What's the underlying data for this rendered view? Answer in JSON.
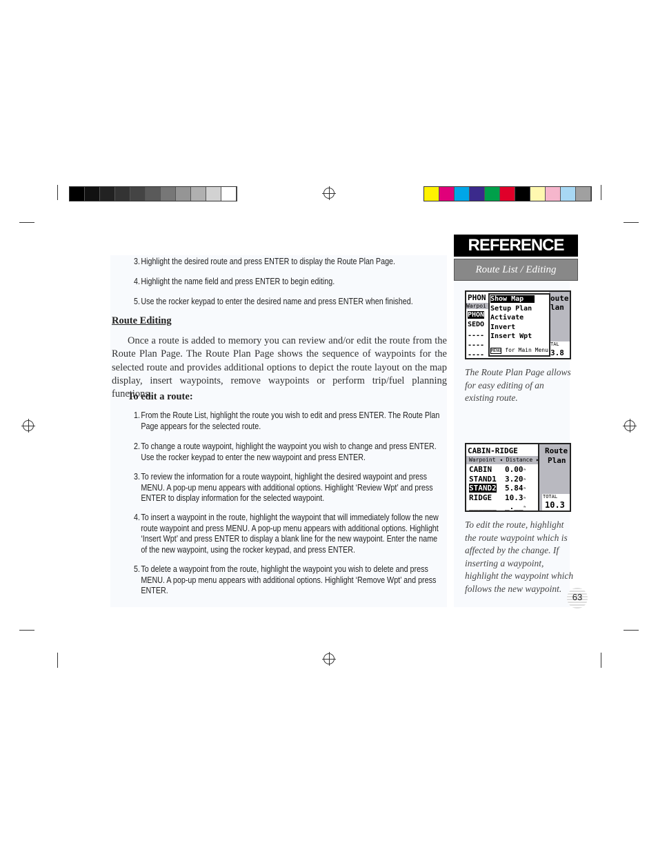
{
  "colorbars": {
    "grayscale": [
      "#000000",
      "#111111",
      "#222222",
      "#333333",
      "#444444",
      "#5a5a5a",
      "#777777",
      "#959595",
      "#b0b0b0",
      "#d2d2d2",
      "#ffffff"
    ],
    "process": [
      "#fff200",
      "#e0007a",
      "#00a6e8",
      "#3b2a8c",
      "#00a04a",
      "#e0002a",
      "#000000",
      "#fff8b0",
      "#f6b6cc",
      "#a8d8f4",
      "#a0a0a0"
    ]
  },
  "steps_top": [
    {
      "num": "3.",
      "text": "Highlight the desired route and press ENTER to display the Route Plan Page."
    },
    {
      "num": "4.",
      "text": "Highlight the name field and press ENTER to begin editing."
    },
    {
      "num": "5.",
      "text": "Use the rocker keypad to enter the desired name and press ENTER when finished."
    }
  ],
  "heading": "Route Editing",
  "paragraph": "Once a route is added to memory you can review and/or edit the route from the Route Plan Page. The Route Plan Page shows the sequence of waypoints for the selected route and provides additional options to depict the route layout on the map display, insert waypoints, remove waypoints or perform trip/fuel planning functions.",
  "subheading": "To edit a route:",
  "steps": [
    {
      "num": "1.",
      "text": "From the Route List, highlight the route you wish to edit and press ENTER. The Route Plan Page appears for the selected route."
    },
    {
      "num": "2.",
      "text": "To change a route waypoint, highlight the waypoint you wish to change and press ENTER. Use the rocker keypad to enter the new waypoint and press ENTER."
    },
    {
      "num": "3.",
      "text": "To review the information for a route waypoint, highlight the desired waypoint and press MENU. A pop-up menu appears with additional options. Highlight ‘Review Wpt’ and press ENTER to display information for the selected waypoint."
    },
    {
      "num": "4.",
      "text": "To insert a waypoint in the route, highlight the waypoint that will immediately follow the new route waypoint and press MENU. A pop-up menu appears with additional options. Highlight ‘Insert Wpt’ and press ENTER to display a blank line for the new waypoint. Enter the name of the new waypoint, using the rocker keypad, and press ENTER."
    },
    {
      "num": "5.",
      "text": "To delete a waypoint from the route, highlight the waypoint you wish to delete and press MENU. A pop-up menu appears with additional options. Highlight ‘Remove Wpt’ and press ENTER."
    }
  ],
  "sidebar": {
    "tab": "REFERENCE",
    "section": "Route List / Editing",
    "caption1": "The Route Plan Page allows for easy editing of an existing route.",
    "caption2": "To edit the route, highlight the route waypoint which is affected by the change. If inserting a waypoint, highlight the waypoint which follows the new waypoint."
  },
  "screen1": {
    "bg_title": "PHON",
    "bg_sub": "Warpoi",
    "bg_rows": [
      "PHON",
      "SEDO",
      "----",
      "----",
      "----"
    ],
    "right_title": "oute",
    "right_sub": "lan",
    "total_label": "TAL",
    "total": "3.8",
    "menu": [
      "Show Map",
      "Setup Plan",
      "Activate",
      "Invert",
      "Insert Wpt"
    ],
    "menu_key": "MENU",
    "menu_hint": "for Main Menu"
  },
  "screen2": {
    "title": "CABIN-RIDGE",
    "col1": "Warpoint",
    "col2": "◂ Distance ▸",
    "rows": [
      {
        "wpt": "CABIN",
        "dist": "0.00"
      },
      {
        "wpt": "STAND1",
        "dist": "3.20"
      },
      {
        "wpt": "STAND2",
        "dist": "5.84"
      },
      {
        "wpt": "RIDGE",
        "dist": "10.3"
      },
      {
        "wpt": "______",
        "dist": "_.__"
      }
    ],
    "side_title": "Route",
    "side_sub": "Plan",
    "total_label": "TOTAL",
    "total": "10.3",
    "unit": "ⁿ"
  },
  "page_number": "63"
}
